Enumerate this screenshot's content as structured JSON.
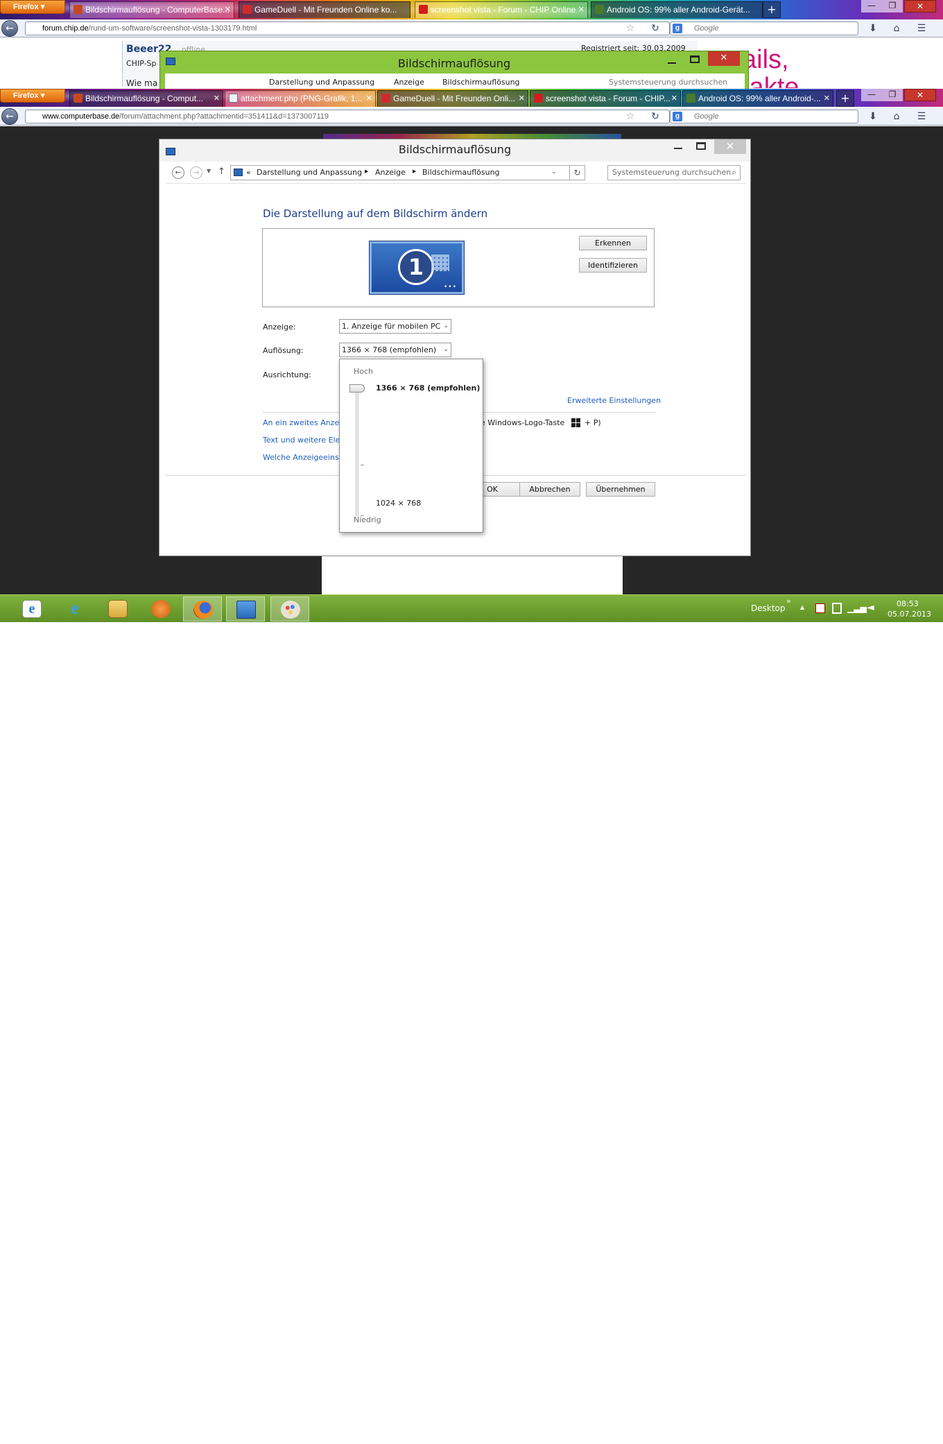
{
  "browser_back": {
    "firefox_label": "Firefox",
    "tabs": [
      {
        "label": "Bildschirmauflösung - ComputerBase..."
      },
      {
        "label": "GameDuell - Mit Freunden Online ko..."
      },
      {
        "label": "screenshot vista - Forum - CHIP Online"
      },
      {
        "label": "Android OS: 99% aller Android-Gerät..."
      }
    ],
    "new_tab": "+",
    "url_host": "forum.chip.de",
    "url_path": "/rund-um-software/screenshot-vista-1303179.html",
    "search_placeholder": "Google",
    "page": {
      "user": "Beeer22",
      "status": "offline",
      "registered": "Registriert seit: 30.03.2009",
      "line1": "CHIP-Sp",
      "line2": "Wie ma",
      "ad_text1": "ails,",
      "ad_text2": "takte"
    },
    "inner_dialog": {
      "title": "Bildschirmauflösung",
      "breadcrumb_1": "Darstellung und Anpassung",
      "breadcrumb_2": "Anzeige",
      "breadcrumb_3": "Bildschirmauflösung",
      "search": "Systemsteuerung durchsuchen"
    }
  },
  "browser_front": {
    "firefox_label": "Firefox",
    "tabs": [
      {
        "label": "Bildschirmauflösung - Comput..."
      },
      {
        "label": "attachment.php (PNG-Grafik, 1..."
      },
      {
        "label": "GameDuell - Mit Freunden Onli..."
      },
      {
        "label": "screenshot vista - Forum - CHIP..."
      },
      {
        "label": "Android OS: 99% aller Android-..."
      }
    ],
    "new_tab": "+",
    "url_host": "www.computerbase.de",
    "url_path": "/forum/attachment.php?attachmentid=351411&d=1373007119",
    "search_placeholder": "Google"
  },
  "dialog": {
    "title": "Bildschirmauflösung",
    "breadcrumb": {
      "prefix": "«",
      "item1": "Darstellung und Anpassung",
      "item2": "Anzeige",
      "item3": "Bildschirmauflösung"
    },
    "search_placeholder": "Systemsteuerung durchsuchen",
    "heading": "Die Darstellung auf dem Bildschirm ändern",
    "monitor_number": "1",
    "btn_detect": "Erkennen",
    "btn_identify": "Identifizieren",
    "label_display": "Anzeige:",
    "display_value": "1. Anzeige für mobilen PC",
    "label_resolution": "Auflösung:",
    "resolution_value": "1366 × 768 (empfohlen)",
    "label_orientation": "Ausrichtung:",
    "link_advanced": "Erweiterte Einstellungen",
    "link_second_display": "An ein zweites Anzeig",
    "second_display_suffix": "e Windows-Logo-Taste",
    "second_display_key_suffix": "+ P)",
    "link_text_size": "Text und weitere Elen",
    "link_which_settings": "Welche Anzeigeeinste",
    "btn_ok": "OK",
    "btn_cancel": "Abbrechen",
    "btn_apply": "Übernehmen"
  },
  "resolution_popup": {
    "label_high": "Hoch",
    "selected": "1366 × 768 (empfohlen)",
    "lowest": "1024 × 768",
    "label_low": "Niedrig",
    "slider_level": 1.0
  },
  "taskbar": {
    "apps": [
      {
        "icon": "metro-ie-icon"
      },
      {
        "icon": "internet-explorer-icon"
      },
      {
        "icon": "file-explorer-icon"
      },
      {
        "icon": "orange-app-icon"
      },
      {
        "icon": "firefox-icon"
      },
      {
        "icon": "control-panel-display-icon"
      },
      {
        "icon": "paint-icon"
      }
    ],
    "desktop_label": "Desktop",
    "chevron": "»",
    "time": "08:53",
    "date": "05.07.2013"
  },
  "colors": {
    "taskbar": "#6a9c2c",
    "link": "#1e5fc0",
    "inner_title_bar": "#8cc63f",
    "close_red": "#c7372d"
  }
}
